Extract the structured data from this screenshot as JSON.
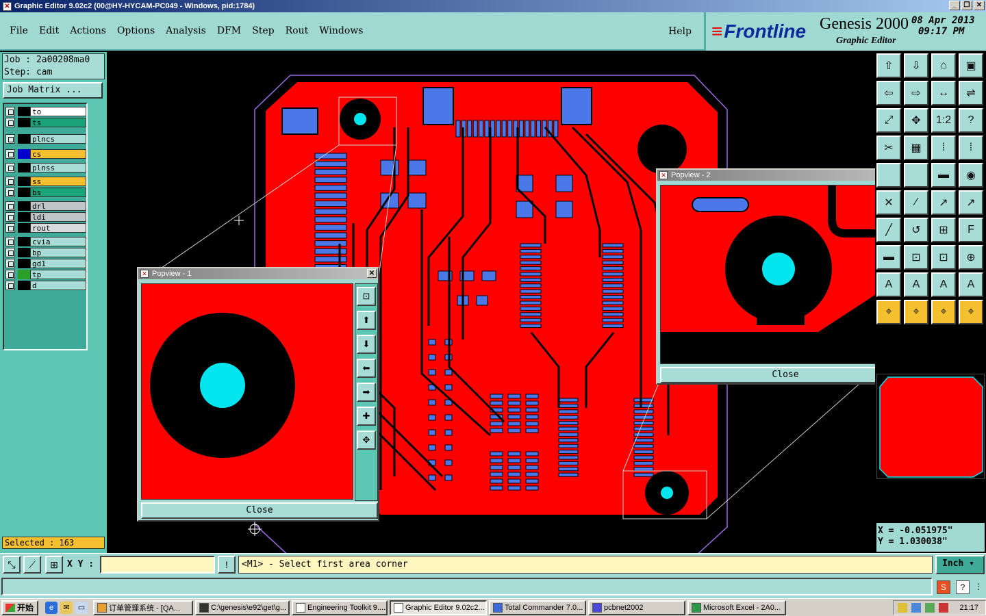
{
  "window": {
    "title": "Graphic Editor 9.02c2 (00@HY-HYCAM-PC049 - Windows, pid:1784)",
    "controls": [
      "_",
      "❐",
      "✕"
    ]
  },
  "menu": {
    "items": [
      "File",
      "Edit",
      "Actions",
      "Options",
      "Analysis",
      "DFM",
      "Step",
      "Rout",
      "Windows"
    ],
    "help": "Help"
  },
  "brand": {
    "logo": "Frontline",
    "product": "Genesis 2000",
    "subtitle": "Graphic Editor",
    "date": "08 Apr 2013",
    "time": "09:17 PM"
  },
  "job": {
    "job_line": "Job : 2a00208ma0",
    "step_line": "Step: cam",
    "matrix_button": "Job Matrix ..."
  },
  "layers": [
    {
      "name": "to",
      "color": "#ffffff",
      "swatch": "#000000"
    },
    {
      "name": "ts",
      "color": "#1aa377",
      "swatch": "#000000"
    },
    {
      "name": "plncs",
      "color": "#a8ddd7",
      "swatch": "#000000"
    },
    {
      "name": "cs",
      "color": "#f5c030",
      "swatch": "#0000cc"
    },
    {
      "name": "plnss",
      "color": "#a8ddd7",
      "swatch": "#000000"
    },
    {
      "name": "ss",
      "color": "#f5c030",
      "swatch": "#000000"
    },
    {
      "name": "bs",
      "color": "#1aa377",
      "swatch": "#000000"
    },
    {
      "name": "drl",
      "color": "#bfc6c6",
      "swatch": "#000000"
    },
    {
      "name": "ldi",
      "color": "#bfc6c6",
      "swatch": "#000000"
    },
    {
      "name": "rout",
      "color": "#d8dcdc",
      "swatch": "#000000"
    },
    {
      "name": "cvia",
      "color": "#a8ddd7",
      "swatch": "#000000"
    },
    {
      "name": "bp",
      "color": "#a8ddd7",
      "swatch": "#000000"
    },
    {
      "name": "gd1",
      "color": "#a8ddd7",
      "swatch": "#000000"
    },
    {
      "name": "tp",
      "color": "#a8ddd7",
      "swatch": "#2aa02a"
    },
    {
      "name": "d",
      "color": "#a8ddd7",
      "swatch": "#000000"
    }
  ],
  "selected": "Selected : 163",
  "popview1": {
    "title": "Popview - 1",
    "close_label": "Close"
  },
  "popview2": {
    "title": "Popview - 2",
    "close_label": "Close"
  },
  "coords": {
    "x": "X = -0.051975\"",
    "y": "Y = 1.030038\""
  },
  "command": {
    "xy_label": "X Y :",
    "xy_value": "",
    "prompt": "<M1> - Select first area corner",
    "units": "Inch"
  },
  "taskbar": {
    "start": "开始",
    "tasks": [
      {
        "label": "订单管理系统 - [QA...",
        "active": false
      },
      {
        "label": "C:\\genesis\\e92\\get\\g...",
        "active": false
      },
      {
        "label": "Engineering Toolkit 9....",
        "active": false
      },
      {
        "label": "Graphic Editor 9.02c2...",
        "active": true
      },
      {
        "label": "Total Commander 7.0...",
        "active": false
      },
      {
        "label": "pcbnet2002",
        "active": false
      },
      {
        "label": "Microsoft Excel - 2A0...",
        "active": false
      }
    ],
    "clock": "21:17"
  },
  "colors": {
    "board": "#ff0000",
    "pad": "#4a78e8",
    "hole": "#00e5ee",
    "panel": "#9fd9d2",
    "panel_dark": "#5ec7b4"
  }
}
